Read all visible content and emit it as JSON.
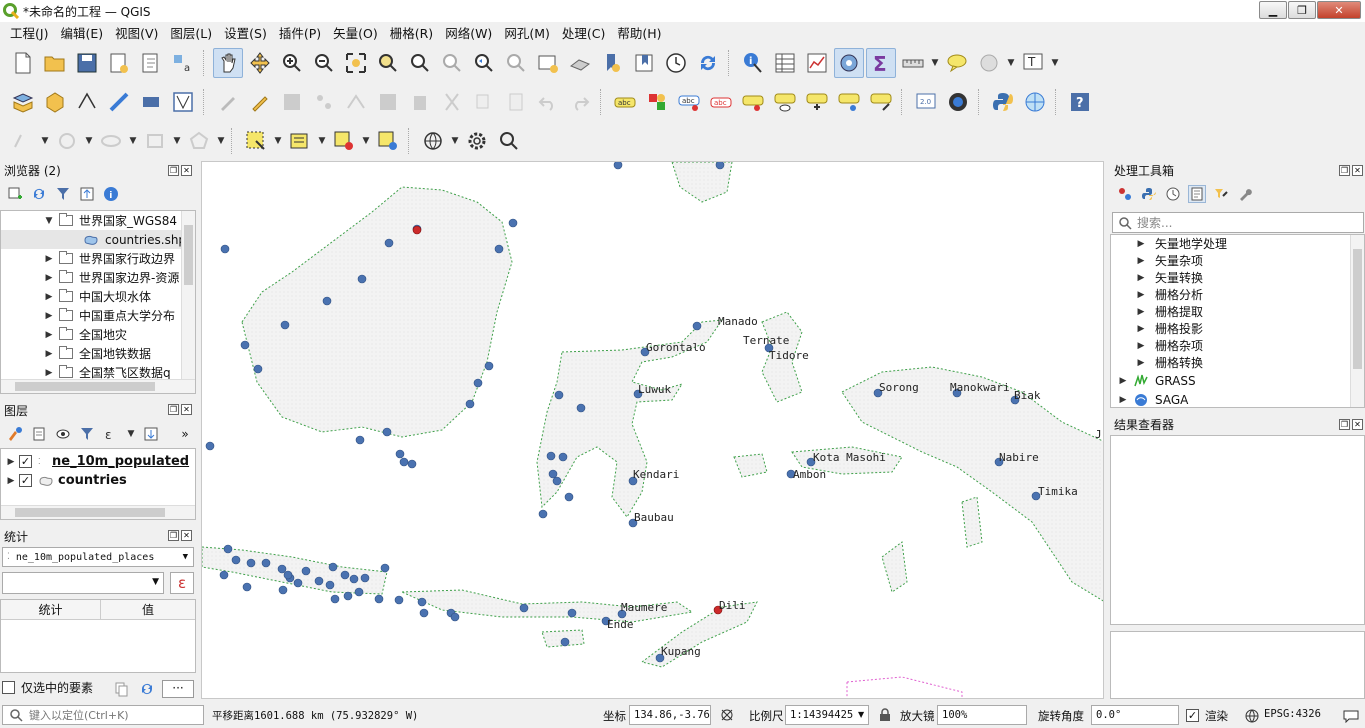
{
  "window": {
    "title": "*未命名的工程 — QGIS"
  },
  "menu": [
    "工程(J)",
    "编辑(E)",
    "视图(V)",
    "图层(L)",
    "设置(S)",
    "插件(P)",
    "矢量(O)",
    "栅格(R)",
    "网络(W)",
    "网孔(M)",
    "处理(C)",
    "帮助(H)"
  ],
  "browser": {
    "title": "浏览器 (2)",
    "items": [
      {
        "label": "世界国家_WGS84",
        "expanded": true
      },
      {
        "label": "countries.shp",
        "child": true
      },
      {
        "label": "世界国家行政边界"
      },
      {
        "label": "世界国家边界-资源"
      },
      {
        "label": "中国大坝水体"
      },
      {
        "label": "中国重点大学分布"
      },
      {
        "label": "全国地灾"
      },
      {
        "label": "全国地铁数据"
      },
      {
        "label": "全国禁飞区数据q"
      }
    ]
  },
  "layers": {
    "title": "图层",
    "items": [
      {
        "label": "ne_10m_populated",
        "checked": true,
        "active": true
      },
      {
        "label": "countries",
        "checked": true
      }
    ]
  },
  "stats": {
    "title": "统计",
    "layer": "ne_10m_populated_places",
    "col_stat": "统计",
    "col_value": "值",
    "selected_only": "仅选中的要素"
  },
  "processing": {
    "title": "处理工具箱",
    "search_placeholder": "搜索...",
    "items": [
      "矢量地学处理",
      "矢量杂项",
      "矢量转换",
      "栅格分析",
      "栅格提取",
      "栅格投影",
      "栅格杂项",
      "栅格转换"
    ],
    "providers": [
      "GRASS",
      "SAGA"
    ]
  },
  "results": {
    "title": "结果查看器"
  },
  "map": {
    "labels": [
      "Manado",
      "Gorontalo",
      "Ternate",
      "Tidore",
      "Luwuk",
      "Sorong",
      "Manokwari",
      "Biak",
      "Kendari",
      "Kota Masohi",
      "Ambon",
      "Nabire",
      "Timika",
      "Baubau",
      "Maumere",
      "Dili",
      "Ende",
      "Kupang",
      "J"
    ],
    "point_color": "#4a72b0",
    "capital_color": "#cc2a2a",
    "land_fill": "#f3f3f3",
    "coast_color": "#3fa04a"
  },
  "status": {
    "locator_placeholder": "键入以定位(Ctrl+K)",
    "message": "平移距离1601.688 km (75.932829° W)",
    "coord_label": "坐标",
    "coord_value": "134.86,-3.76",
    "scale_label": "比例尺",
    "scale_value": "1:14394425",
    "magnifier_label": "放大镜",
    "magnifier_value": "100%",
    "rotation_label": "旋转角度",
    "rotation_value": "0.0°",
    "render_label": "渲染",
    "crs": "EPSG:4326"
  }
}
